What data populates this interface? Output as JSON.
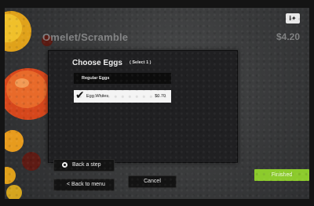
{
  "header": {
    "item_title": "Omelet/Scramble",
    "item_price": "$4.20",
    "info_icon": "nutrition-info-icon"
  },
  "modal": {
    "title": "Choose Eggs",
    "subtitle": "( Select 1 )",
    "options": [
      {
        "label": "Regular Eggs",
        "price": "",
        "selected": false
      },
      {
        "label": "Egg Whites",
        "price": "$0.70",
        "selected": true
      }
    ]
  },
  "footer": {
    "back_step_label": "Back a step",
    "back_menu_label": "< Back to menu",
    "cancel_label": "Cancel",
    "finished_label": "Finished"
  },
  "colors": {
    "finished_button": "#8ccb2c",
    "modal_background": "#202022",
    "screen_background": "#3a3b3c"
  },
  "icons": {
    "selected_option": "checkmark-icon",
    "back_step": "radio-dot-icon",
    "decor": "produce-image"
  }
}
